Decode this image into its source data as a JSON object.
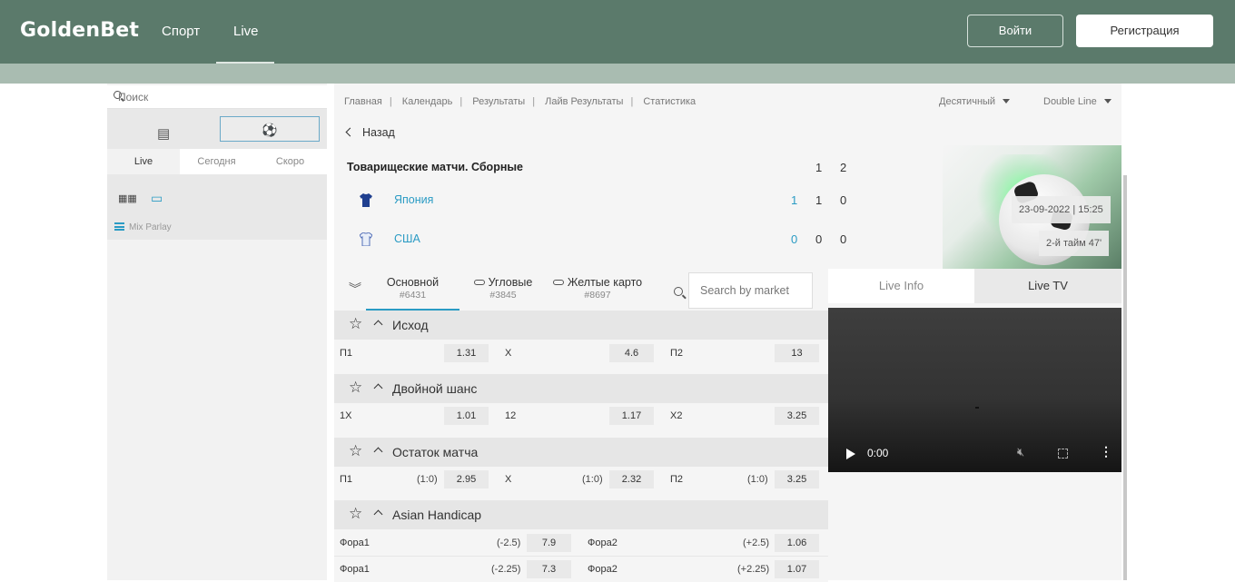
{
  "header": {
    "logo": "GoldenBet",
    "nav": [
      "Спорт",
      "Live"
    ],
    "login": "Войти",
    "register": "Регистрация"
  },
  "sidebar": {
    "search_placeholder": "Поиск",
    "tabs": [
      "Live",
      "Сегодня",
      "Скоро"
    ],
    "mix_parlay": "Mix Parlay"
  },
  "main": {
    "breadcrumbs": [
      "Главная",
      "Календарь",
      "Результаты",
      "Лайв Результаты",
      "Статистика"
    ],
    "odds_format": "Десятичный",
    "view_mode": "Double Line",
    "back": "Назад",
    "match": {
      "competition": "Товарищеские матчи. Сборные",
      "periods": [
        "1",
        "2"
      ],
      "teams": [
        {
          "name": "Япония",
          "current": "1",
          "p1": "1",
          "p2": "0"
        },
        {
          "name": "США",
          "current": "0",
          "p1": "0",
          "p2": "0"
        }
      ],
      "datetime": "23-09-2022 | 15:25",
      "half": "2-й тайм 47'"
    },
    "market_tabs": [
      {
        "label": "Основной",
        "count": "#6431"
      },
      {
        "label": "Угловые",
        "count": "#3845"
      },
      {
        "label": "Желтые карто",
        "count": "#8697"
      }
    ],
    "market_search_placeholder": "Search by market",
    "markets": [
      {
        "name": "Исход",
        "rows": [
          [
            {
              "label": "П1",
              "odd": "1.31"
            },
            {
              "label": "X",
              "odd": "4.6"
            },
            {
              "label": "П2",
              "odd": "13"
            }
          ]
        ]
      },
      {
        "name": "Двойной шанс",
        "rows": [
          [
            {
              "label": "1X",
              "odd": "1.01"
            },
            {
              "label": "12",
              "odd": "1.17"
            },
            {
              "label": "X2",
              "odd": "3.25"
            }
          ]
        ]
      },
      {
        "name": "Остаток матча",
        "rows": [
          [
            {
              "label": "П1",
              "hcp": "(1:0)",
              "odd": "2.95"
            },
            {
              "label": "X",
              "hcp": "(1:0)",
              "odd": "2.32"
            },
            {
              "label": "П2",
              "hcp": "(1:0)",
              "odd": "3.25"
            }
          ]
        ]
      },
      {
        "name": "Asian Handicap",
        "rows": [
          [
            {
              "label": "Фора1",
              "hcp": "(-2.5)",
              "odd": "7.9"
            },
            {
              "label": "Фора2",
              "hcp": "(+2.5)",
              "odd": "1.06"
            }
          ],
          [
            {
              "label": "Фора1",
              "hcp": "(-2.25)",
              "odd": "7.3"
            },
            {
              "label": "Фора2",
              "hcp": "(+2.25)",
              "odd": "1.07"
            }
          ]
        ]
      }
    ]
  },
  "right_panel": {
    "tabs": [
      "Live Info",
      "Live TV"
    ],
    "video_time": "0:00"
  }
}
